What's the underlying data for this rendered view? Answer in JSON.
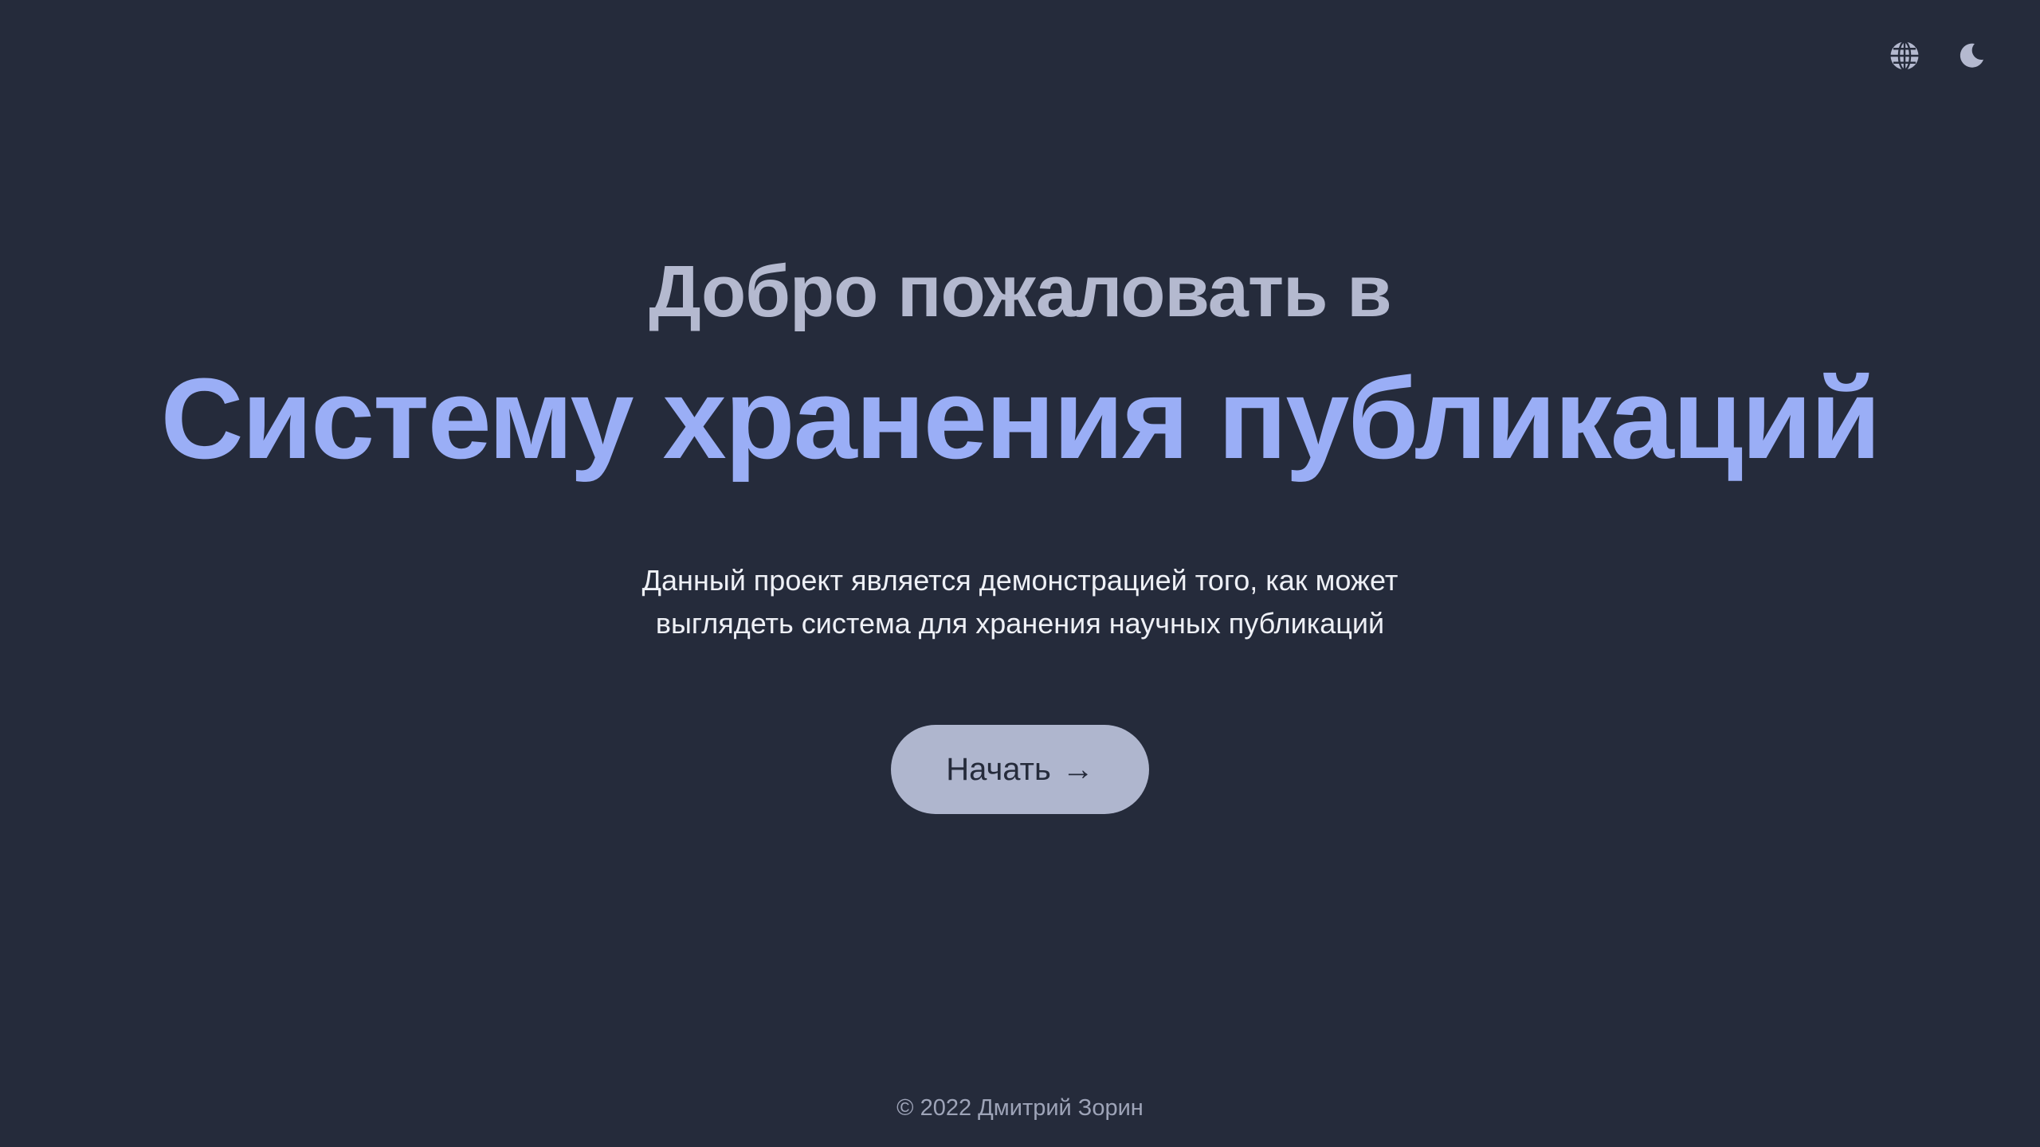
{
  "header": {
    "language_icon": "globe-icon",
    "theme_icon": "moon-icon"
  },
  "hero": {
    "welcome": "Добро пожаловать в",
    "title": "Систему хранения публикаций",
    "description_line1": "Данный проект является демонстрацией того, как может",
    "description_line2": "выглядеть система для хранения научных публикаций",
    "start_label": "Начать",
    "start_arrow": "→"
  },
  "footer": {
    "copyright": "© 2022 Дмитрий Зорин"
  },
  "colors": {
    "background": "#252b3b",
    "accent": "#9aaef6",
    "muted_heading": "#b4b9cf",
    "button_bg": "#afb6ce"
  }
}
